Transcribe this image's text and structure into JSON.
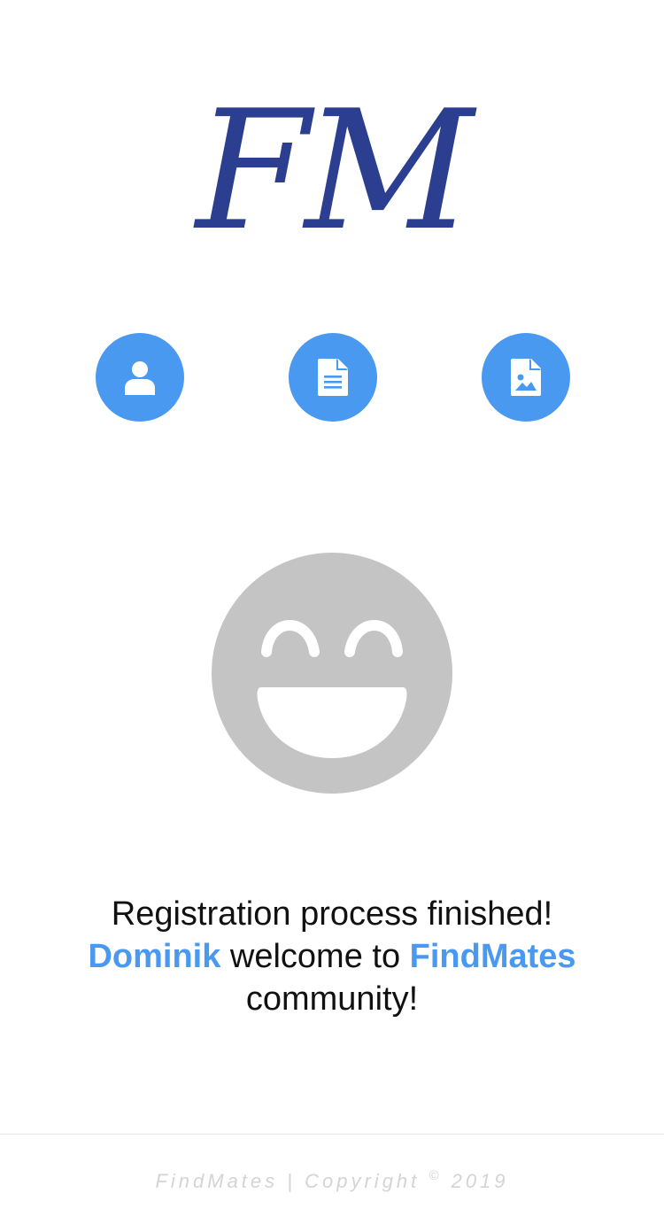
{
  "logo": {
    "text": "FM"
  },
  "steps": [
    {
      "icon": "user-icon"
    },
    {
      "icon": "document-icon"
    },
    {
      "icon": "image-file-icon"
    }
  ],
  "illustration": {
    "icon": "grinning-face-icon"
  },
  "message": {
    "line1": "Registration process finished!",
    "user_name": "Dominik",
    "welcome_text": " welcome to ",
    "brand": "FindMates",
    "line3": "community!"
  },
  "footer": {
    "brand": "FindMates",
    "separator": " | ",
    "copyright_label": "Copyright ",
    "copyright_symbol": "©",
    "year": " 2019"
  },
  "colors": {
    "accent": "#4a99f0",
    "logo": "#2b3e8f",
    "smiley": "#c4c4c4",
    "footer_text": "#d4d4d4"
  }
}
